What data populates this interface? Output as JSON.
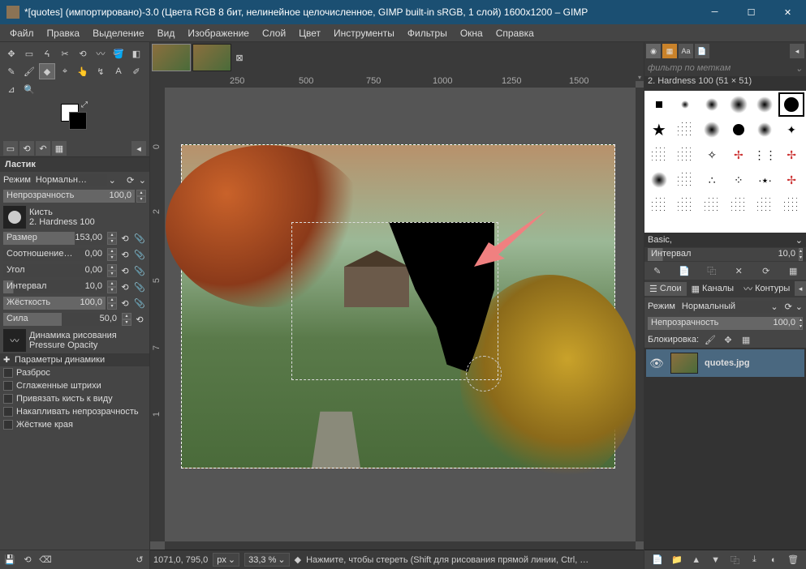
{
  "window": {
    "title": "*[quotes] (импортировано)-3.0 (Цвета RGB 8 бит, нелинейное целочисленное, GIMP built-in sRGB, 1 слой) 1600x1200 – GIMP"
  },
  "menu": {
    "file": "Файл",
    "edit": "Правка",
    "select": "Выделение",
    "view": "Вид",
    "image": "Изображение",
    "layer": "Слой",
    "colors": "Цвет",
    "tools": "Инструменты",
    "filters": "Фильтры",
    "windows": "Окна",
    "help": "Справка"
  },
  "toolOptions": {
    "toolName": "Ластик",
    "modeLabel": "Режим",
    "modeValue": "Нормальн…",
    "opacityLabel": "Непрозрачность",
    "opacityValue": "100,0",
    "brushLabel": "Кисть",
    "brushName": "2. Hardness 100",
    "sizeLabel": "Размер",
    "sizeValue": "153,00",
    "aspectLabel": "Соотношение…",
    "aspectValue": "0,00",
    "angleLabel": "Угол",
    "angleValue": "0,00",
    "spacingLabel": "Интервал",
    "spacingValue": "10,0",
    "hardnessLabel": "Жёсткость",
    "hardnessValue": "100,0",
    "forceLabel": "Сила",
    "forceValue": "50,0",
    "dynamicsLabel": "Динамика рисования",
    "dynamicsValue": "Pressure Opacity",
    "dynamicsParams": "Параметры динамики",
    "scatter": "Разброс",
    "smoothStrokes": "Сглаженные штрихи",
    "lockBrush": "Привязать кисть к виду",
    "accumulateOpacity": "Накапливать непрозрачность",
    "hardEdge": "Жёсткие края"
  },
  "ruler": {
    "h250": "250",
    "h500": "500",
    "h750": "750",
    "h1000": "1000",
    "h1250": "1250",
    "h1500": "1500",
    "v0": "0",
    "v2": "2",
    "v5": "5",
    "v7": "7",
    "v1": "1"
  },
  "status": {
    "coords": "1071,0, 795,0",
    "unit": "px",
    "zoom": "33,3 %",
    "hint": "Нажмите, чтобы стереть (Shift для рисования прямой линии, Ctrl, …"
  },
  "brushDock": {
    "filterPlaceholder": "фильтр по меткам",
    "brushInfo": "2. Hardness 100 (51 × 51)",
    "preset": "Basic,",
    "spacingLabel": "Интервал",
    "spacingValue": "10,0"
  },
  "layersDock": {
    "tabLayers": "Слои",
    "tabChannels": "Каналы",
    "tabPaths": "Контуры",
    "modeLabel": "Режим",
    "modeValue": "Нормальный",
    "opacityLabel": "Непрозрачность",
    "opacityValue": "100,0",
    "lockLabel": "Блокировка:",
    "layerName": "quotes.jpg"
  }
}
